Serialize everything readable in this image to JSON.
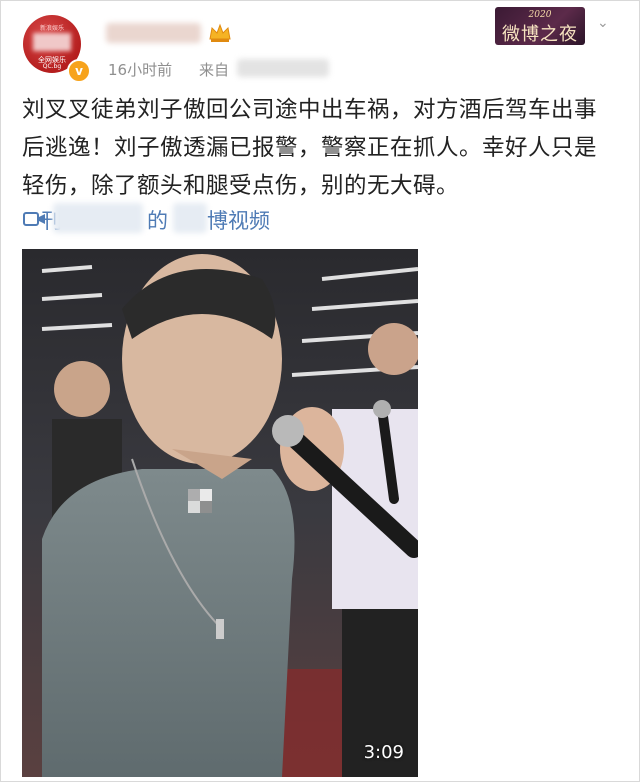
{
  "header": {
    "avatar": {
      "top_text": "新浪娱乐",
      "line1": "全网娱乐",
      "line2": "QC.bg"
    },
    "verified_badge": "v",
    "post_time": "16小时前",
    "source_prefix": "来自",
    "event_logo": {
      "year": "2020",
      "name": "微博之夜"
    }
  },
  "post": {
    "text": "刘叉叉徒弟刘子傲回公司途中出车祸，对方酒后驾车出事后逃逸！刘子傲透漏已报警，警察正在抓人。幸好人只是轻伤，除了额头和腿受点伤，别的无大碍。"
  },
  "video_link": {
    "prefix": "刊",
    "middle": "的",
    "suffix": "博视频"
  },
  "video": {
    "duration": "3:09"
  },
  "colors": {
    "link": "#4f7bb5",
    "meta": "#8f8f8f",
    "badge": "#f7a31c",
    "avatar": "#b51e1e"
  }
}
